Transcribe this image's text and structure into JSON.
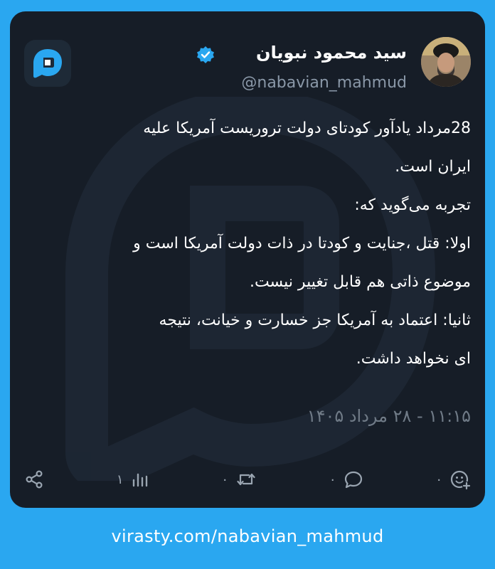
{
  "post": {
    "display_name": "سید محمود نبویان",
    "handle": "@nabavian_mahmud",
    "body_lines": [
      "28مرداد یادآور کودتای دولت تروریست آمریکا علیه",
      "ایران است.",
      " تجربه می‌گوید که:",
      "اولا: قتل ،جنایت و کودتا در ذات دولت آمریکا است و",
      "موضوع ذاتی هم قابل تغییر نیست.",
      "ثانیا: اعتماد به آمریکا جز خسارت و خیانت، نتیجه",
      "ای نخواهد داشت."
    ],
    "timestamp": "۱۱:۱۵ - ۲۸ مرداد ۱۴۰۵"
  },
  "actions": {
    "reaction_count": "۰",
    "reply_count": "۰",
    "repost_count": "۰",
    "views_count": "۱"
  },
  "footer": {
    "link": "virasty.com/nabavian_mahmud"
  },
  "icons": {
    "app_logo": "virasty-logo-icon",
    "verified": "verified-badge-icon",
    "reaction": "add-reaction-icon",
    "reply": "reply-icon",
    "repost": "repost-icon",
    "views": "views-chart-icon",
    "share": "share-icon"
  },
  "colors": {
    "background": "#2aa7f0",
    "card": "#161d27",
    "verified": "#2aa7f0",
    "muted": "#8a98a8"
  }
}
